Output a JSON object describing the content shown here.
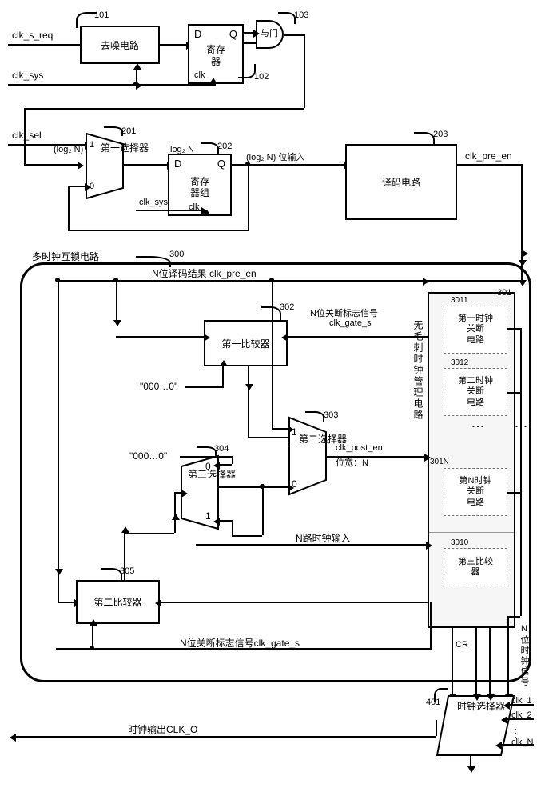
{
  "signals": {
    "clk_s_req": "clk_s_req",
    "clk_sys": "clk_sys",
    "clk_sel": "clk_sel",
    "clk_sys2": "clk_sys",
    "clk_pre_en": "clk_pre_en",
    "n_bit_decode_result": "N位译码结果 clk_pre_en",
    "n_bit_shutdown_flag": "N位关断标志信号",
    "clk_gate_s": "clk_gate_s",
    "clk_post_en": "clk_post_en",
    "bit_width_n": "位宽：N",
    "n_clock_input": "N路时钟输入",
    "n_bit_shutdown_flag_bottom": "N位关断标志信号clk_gate_s",
    "cr": "CR",
    "n_bit_clock_signal": "N位时钟信号",
    "clock_output": "时钟输出CLK_O",
    "clk_1": "clk_1",
    "clk_2": "clk_2",
    "clk_n": "clk_N",
    "log2n": "log₂ N",
    "log2n_p": "(log₂ N)",
    "log2n_input": "(log₂ N) 位输入",
    "zeros": "\"000…0\"",
    "zeros2": "\"000…0\""
  },
  "blocks": {
    "b101": "去噪电路",
    "b102_d": "D",
    "b102_q": "Q",
    "b102_name": "寄存\n器",
    "b102_clk": "clk",
    "b103": "与门",
    "b201_name": "第一选择器",
    "b201_1": "1",
    "b201_0": "0",
    "b202_d": "D",
    "b202_q": "Q",
    "b202_name": "寄存\n器组",
    "b202_clk": "clk",
    "b203": "译码电路",
    "b300_title": "多时钟互锁电路",
    "b301_name": "无毛刺时钟管理电路",
    "b3011": "第一时钟\n关断\n电路",
    "b3012": "第二时钟\n关断\n电路",
    "b301N": "第N时钟\n关断\n电路",
    "b3010": "第三比较\n器",
    "b302": "第一比较器",
    "b303_name": "第二选择器",
    "b303_1": "1",
    "b303_0": "0",
    "b304_name": "第三选择器",
    "b304_0": "0",
    "b304_1": "1",
    "b305": "第二比较器",
    "b401_name": "时钟选择器"
  },
  "refs": {
    "r101": "101",
    "r102": "102",
    "r103": "103",
    "r201": "201",
    "r202": "202",
    "r203": "203",
    "r300": "300",
    "r301": "301",
    "r302": "302",
    "r303": "303",
    "r304": "304",
    "r305": "305",
    "r3011": "3011",
    "r3012": "3012",
    "r301N": "301N",
    "r3010": "3010",
    "r401": "401"
  }
}
